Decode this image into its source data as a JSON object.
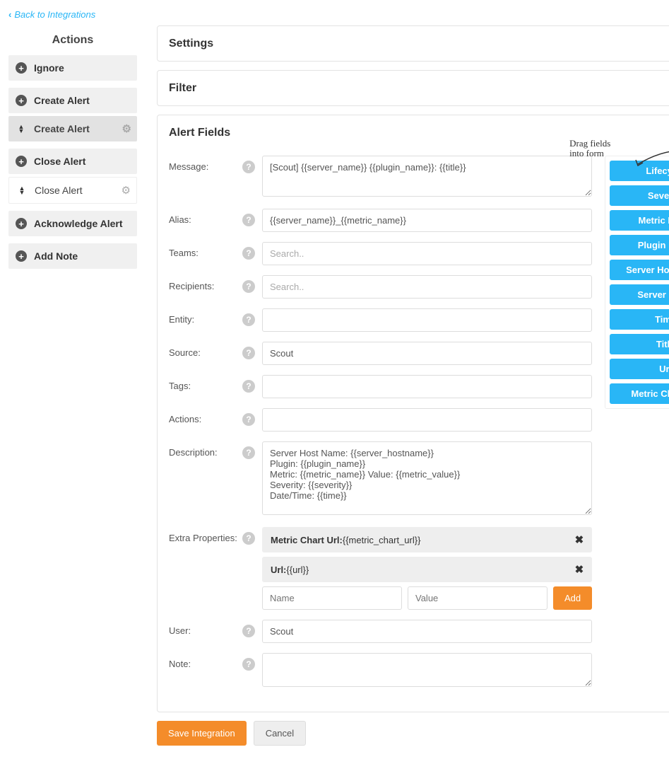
{
  "back_link": "Back to Integrations",
  "sidebar": {
    "title": "Actions",
    "groups": [
      {
        "label": "Ignore",
        "subs": []
      },
      {
        "label": "Create Alert",
        "subs": [
          {
            "label": "Create Alert",
            "active": true
          }
        ]
      },
      {
        "label": "Close Alert",
        "subs": [
          {
            "label": "Close Alert",
            "active": false
          }
        ]
      },
      {
        "label": "Acknowledge Alert",
        "subs": []
      },
      {
        "label": "Add Note",
        "subs": []
      }
    ]
  },
  "panels": {
    "settings": "Settings",
    "filter": "Filter",
    "alert_fields": "Alert Fields"
  },
  "drag_hint": "Drag fields\ninto form",
  "form": {
    "message": {
      "label": "Message:",
      "value": "[Scout] {{server_name}} {{plugin_name}}: {{title}}"
    },
    "alias": {
      "label": "Alias:",
      "value": "{{server_name}}_{{metric_name}}"
    },
    "teams": {
      "label": "Teams:",
      "placeholder": "Search.."
    },
    "recipients": {
      "label": "Recipients:",
      "placeholder": "Search.."
    },
    "entity": {
      "label": "Entity:",
      "value": ""
    },
    "source": {
      "label": "Source:",
      "value": "Scout"
    },
    "tags": {
      "label": "Tags:",
      "value": ""
    },
    "actions": {
      "label": "Actions:",
      "value": ""
    },
    "description": {
      "label": "Description:",
      "value": "Server Host Name: {{server_hostname}}\nPlugin: {{plugin_name}}\nMetric: {{metric_name}} Value: {{metric_value}}\nSeverity: {{severity}}\nDate/Time: {{time}}"
    },
    "extra": {
      "label": "Extra Properties:",
      "rows": [
        {
          "name": "Metric Chart Url:",
          "value": "{{metric_chart_url}}"
        },
        {
          "name": "Url:",
          "value": "{{url}}"
        }
      ],
      "name_placeholder": "Name",
      "value_placeholder": "Value",
      "add_label": "Add"
    },
    "user": {
      "label": "User:",
      "value": "Scout"
    },
    "note": {
      "label": "Note:",
      "value": ""
    }
  },
  "draggable_fields": [
    "Lifecycle",
    "Severity",
    "Metric Name",
    "Plugin Name",
    "Server Host Name",
    "Server Name",
    "Time",
    "Title",
    "Url",
    "Metric Chart Url"
  ],
  "buttons": {
    "save": "Save Integration",
    "cancel": "Cancel"
  }
}
